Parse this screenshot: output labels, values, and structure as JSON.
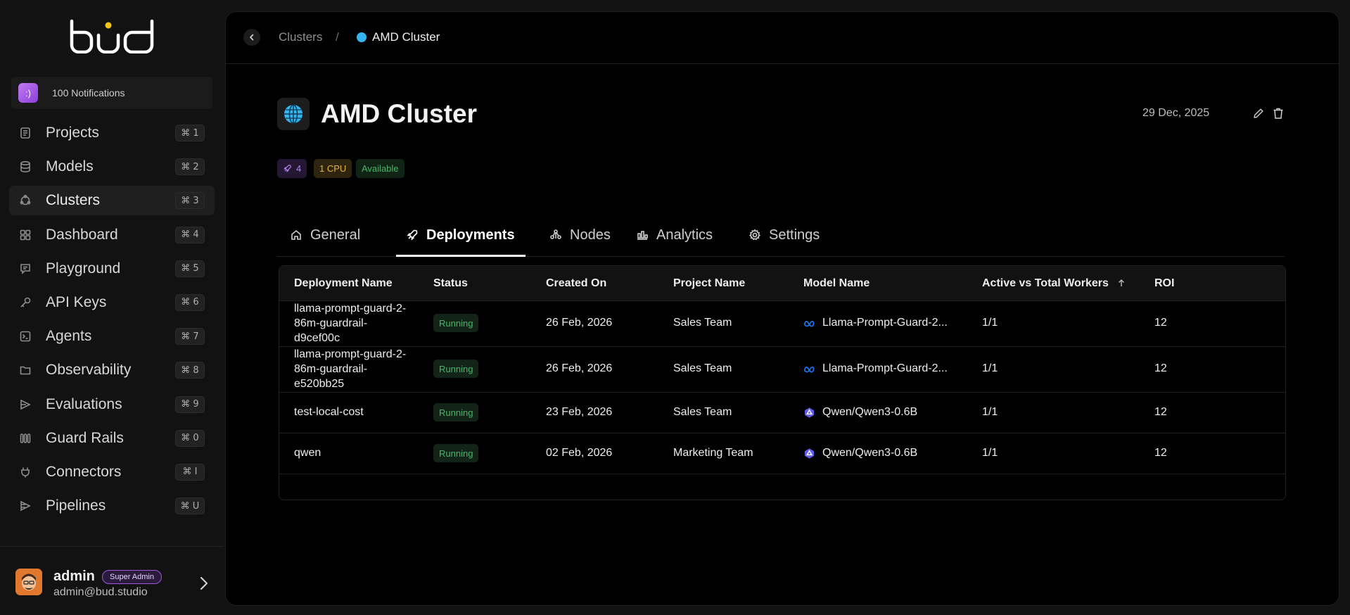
{
  "logo_text": "bud",
  "notifications": {
    "label": "100 Notifications"
  },
  "sidebar": {
    "items": [
      {
        "label": "Projects",
        "shortcut": "⌘ 1",
        "icon": "document-icon"
      },
      {
        "label": "Models",
        "shortcut": "⌘ 2",
        "icon": "database-icon"
      },
      {
        "label": "Clusters",
        "shortcut": "⌘ 3",
        "icon": "cluster-icon"
      },
      {
        "label": "Dashboard",
        "shortcut": "⌘ 4",
        "icon": "grid-icon"
      },
      {
        "label": "Playground",
        "shortcut": "⌘ 5",
        "icon": "chat-icon"
      },
      {
        "label": "API Keys",
        "shortcut": "⌘ 6",
        "icon": "key-icon"
      },
      {
        "label": "Agents",
        "shortcut": "⌘ 7",
        "icon": "terminal-icon"
      },
      {
        "label": "Observability",
        "shortcut": "⌘ 8",
        "icon": "folder-icon"
      },
      {
        "label": "Evaluations",
        "shortcut": "⌘ 9",
        "icon": "evaluation-icon"
      },
      {
        "label": "Guard Rails",
        "shortcut": "⌘ 0",
        "icon": "guardrail-icon"
      },
      {
        "label": "Connectors",
        "shortcut": "⌘ I",
        "icon": "plug-icon"
      },
      {
        "label": "Pipelines",
        "shortcut": "⌘ U",
        "icon": "pipeline-icon"
      }
    ],
    "active_index": 2
  },
  "user": {
    "name": "admin",
    "role": "Super Admin",
    "email": "admin@bud.studio"
  },
  "breadcrumb": {
    "parent": "Clusters",
    "separator": "/",
    "current": "AMD Cluster"
  },
  "header": {
    "title": "AMD Cluster",
    "date": "29 Dec, 2025",
    "tags": {
      "deployments_count": "4",
      "cpu": "1 CPU",
      "availability": "Available"
    }
  },
  "tabs": [
    {
      "label": "General",
      "icon": "home-icon"
    },
    {
      "label": "Deployments",
      "icon": "rocket-icon"
    },
    {
      "label": "Nodes",
      "icon": "nodes-icon"
    },
    {
      "label": "Analytics",
      "icon": "analytics-icon"
    },
    {
      "label": "Settings",
      "icon": "gear-icon"
    }
  ],
  "active_tab": "Deployments",
  "table": {
    "columns": [
      "Deployment Name",
      "Status",
      "Created On",
      "Project Name",
      "Model Name",
      "Active vs Total Workers",
      "ROI"
    ],
    "sort_column": "Active vs Total Workers",
    "sort_direction": "ascending",
    "rows": [
      {
        "name": "llama-prompt-guard-2-86m-guardrail-d9cef00c",
        "status": "Running",
        "created": "26 Feb, 2026",
        "project": "Sales Team",
        "model": "Llama-Prompt-Guard-2...",
        "model_icon": "meta-icon",
        "workers": "1/1",
        "roi": "12"
      },
      {
        "name": "llama-prompt-guard-2-86m-guardrail-e520bb25",
        "status": "Running",
        "created": "26 Feb, 2026",
        "project": "Sales Team",
        "model": "Llama-Prompt-Guard-2...",
        "model_icon": "meta-icon",
        "workers": "1/1",
        "roi": "12"
      },
      {
        "name": "test-local-cost",
        "status": "Running",
        "created": "23 Feb, 2026",
        "project": "Sales Team",
        "model": "Qwen/Qwen3-0.6B",
        "model_icon": "qwen-icon",
        "workers": "1/1",
        "roi": "12"
      },
      {
        "name": "qwen",
        "status": "Running",
        "created": "02 Feb, 2026",
        "project": "Marketing Team",
        "model": "Qwen/Qwen3-0.6B",
        "model_icon": "qwen-icon",
        "workers": "1/1",
        "roi": "12"
      }
    ]
  },
  "colors": {
    "background": "#121212",
    "panel": "#000000",
    "status_green": "#4CB56A",
    "cpu_tag": "#E4B43E",
    "count_tag": "#B784F0",
    "accent_logo_dot": "#F5C518",
    "meta_blue": "#1877F2"
  }
}
